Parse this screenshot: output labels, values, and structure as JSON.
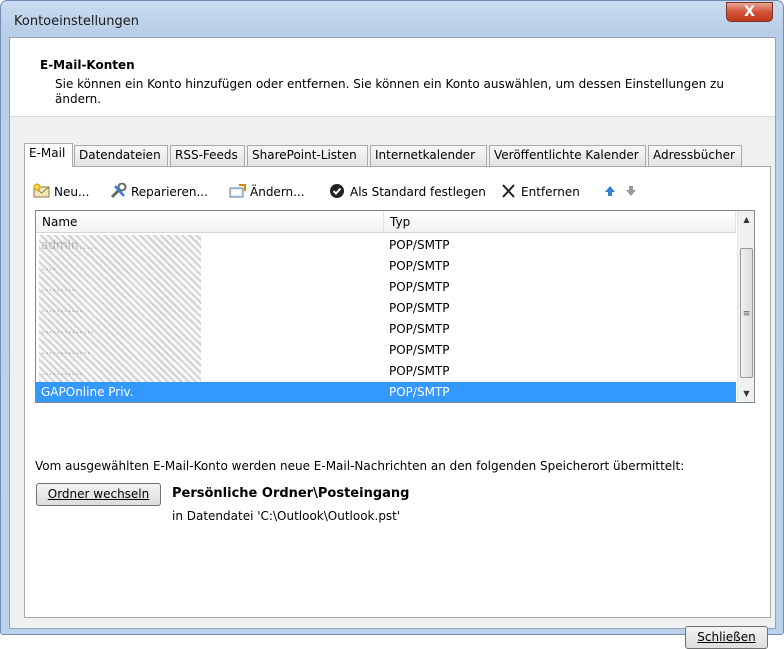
{
  "window": {
    "title": "Kontoeinstellungen",
    "close_glyph": "X"
  },
  "header": {
    "title": "E-Mail-Konten",
    "description": "Sie können ein Konto hinzufügen oder entfernen. Sie können ein Konto auswählen, um dessen Einstellungen zu ändern."
  },
  "tabs": [
    {
      "label": "E-Mail",
      "active": true
    },
    {
      "label": "Datendateien"
    },
    {
      "label": "RSS-Feeds"
    },
    {
      "label": "SharePoint-Listen"
    },
    {
      "label": "Internetkalender"
    },
    {
      "label": "Veröffentlichte Kalender"
    },
    {
      "label": "Adressbücher"
    }
  ],
  "toolbar": {
    "new_label": "Neu...",
    "repair_label": "Reparieren...",
    "change_label": "Ändern...",
    "default_label": "Als Standard festlegen",
    "remove_label": "Entfernen",
    "icons": [
      "new-mail-icon",
      "repair-icon",
      "change-icon",
      "checkmark-icon",
      "remove-x-icon",
      "arrow-up-icon",
      "arrow-down-icon"
    ]
  },
  "accounts": {
    "columns": {
      "name": "Name",
      "type": "Typ"
    },
    "rows": [
      {
        "name": "",
        "type": "POP/SMTP",
        "redacted": true
      },
      {
        "name": "",
        "type": "POP/SMTP",
        "redacted": true
      },
      {
        "name": "",
        "type": "POP/SMTP",
        "redacted": true
      },
      {
        "name": "",
        "type": "POP/SMTP",
        "redacted": true
      },
      {
        "name": "",
        "type": "POP/SMTP",
        "redacted": true
      },
      {
        "name": "",
        "type": "POP/SMTP",
        "redacted": true
      },
      {
        "name": "",
        "type": "POP/SMTP",
        "redacted": true
      },
      {
        "name": "GAPOnline Priv.",
        "type": "POP/SMTP",
        "selected": true
      }
    ]
  },
  "delivery": {
    "info": "Vom ausgewählten E-Mail-Konto werden neue E-Mail-Nachrichten an den folgenden Speicherort übermittelt:",
    "change_folder_label": "Ordner wechseln",
    "folder_path": "Persönliche Ordner\\Posteingang",
    "data_file": "in Datendatei 'C:\\Outlook\\Outlook.pst'"
  },
  "footer": {
    "close_label": "Schließen"
  },
  "colors": {
    "selection": "#3399ff",
    "arrow_up": "#2f7fd8",
    "arrow_down": "#9a9a9a"
  }
}
